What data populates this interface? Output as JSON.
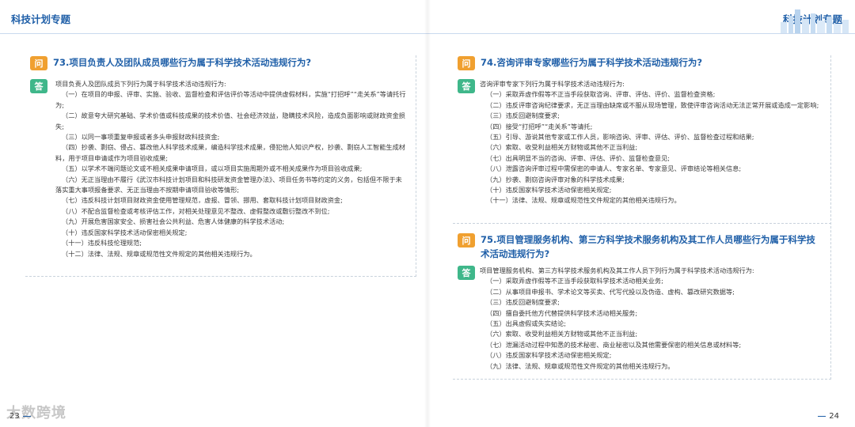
{
  "header": {
    "left_title": "科技计划专题",
    "right_title": "科技计划专题"
  },
  "icons": {
    "question": "问",
    "answer": "答"
  },
  "q73": {
    "question": "73.项目负责人及团队成员哪些行为属于科学技术活动违规行为?",
    "intro": "项目负责人及团队成员下列行为属于科学技术活动违规行为:",
    "items": [
      "（一）在项目的申报、评审、实施、验收、监督检查和评估评价等活动中提供虚假材料，实施“打招呼”“走关系”等请托行为;",
      "（二）故意夸大研究基础、学术价值或科技成果的技术价值、社会经济效益，隐瞒技术风险，造成负面影响或财政资金损失;",
      "（三）以同一事项重复申报或者多头申报财政科技资金;",
      "（四）抄袭、剽窃、侵占、篡改他人科学技术成果，编造科学技术成果，侵犯他人知识产权，抄袭、剽窃人工智能生成材料，用于项目申请或作为项目验收成果;",
      "（五）以学术不端问题论文或不相关成果申请项目，或以项目实施周期外或不相关成果作为项目验收成果;",
      "（六）无正当理由不履行《武汉市科技计划项目和科技研发资金管理办法》、项目任务书等约定的义务，包括但不限于未落实重大事项报备要求、无正当理由不按期申请项目验收等情形;",
      "（七）违反科技计划项目财政资金使用管理规范，虚报、冒领、挪用、套取科技计划项目财政资金;",
      "（八）不配合监督检查或考核评估工作，对相关处理意见不整改、虚假整改或敷衍整改不到位;",
      "（九）开展危害国家安全、损害社会公共利益、危害人体健康的科学技术活动;",
      "（十）违反国家科学技术活动保密相关规定;",
      "（十一）违反科技伦理规范;",
      "（十二）法律、法规、规章或规范性文件规定的其他相关违规行为。"
    ]
  },
  "q74": {
    "question": "74.咨询评审专家哪些行为属于科学技术活动违规行为?",
    "intro": "咨询评审专家下列行为属于科学技术活动违规行为:",
    "items": [
      "（一）采取弄虚作假等不正当手段获取咨询、评审、评估、评价、监督检查资格;",
      "（二）违反评审咨询纪律要求，无正当理由缺席或不服从现场管理，致使评审咨询活动无法正常开展或造成一定影响;",
      "（三）违反回避制度要求;",
      "（四）接受“打招呼”“走关系”等请托;",
      "（五）引导、游说其他专家或工作人员，影响咨询、评审、评估、评价、监督检查过程和结果;",
      "（六）索取、收受利益相关方财物或其他不正当利益;",
      "（七）出具明显不当的咨询、评审、评估、评价、监督检查意见;",
      "（八）泄露咨询评审过程中需保密的申请人、专家名单、专家意见、评审结论等相关信息;",
      "（九）抄袭、剽窃咨询评审对象的科学技术成果;",
      "（十）违反国家科学技术活动保密相关规定;",
      "（十一）法律、法规、规章或规范性文件规定的其他相关违规行为。"
    ]
  },
  "q75": {
    "question": "75.项目管理服务机构、第三方科学技术服务机构及其工作人员哪些行为属于科学技术活动违规行为?",
    "intro": "项目管理服务机构、第三方科学技术服务机构及其工作人员下列行为属于科学技术活动违规行为:",
    "items": [
      "（一）采取弄虚作假等不正当手段获取科学技术活动相关业务;",
      "（二）从事项目申报书、学术论文等买卖、代写代投以及伪造、虚构、篡改研究数据等;",
      "（三）违反回避制度要求;",
      "（四）擅自委托他方代替提供科学技术活动相关服务;",
      "（五）出具虚假或失实结论;",
      "（六）索取、收受利益相关方财物或其他不正当利益;",
      "（七）泄漏活动过程中知悉的技术秘密、商业秘密以及其他需要保密的相关信息或材料等;",
      "（八）违反国家科学技术活动保密相关规定;",
      "（九）法律、法规、规章或规范性文件规定的其他相关违规行为。"
    ]
  },
  "footer": {
    "left_page": "23",
    "right_page": "24",
    "watermark": "大数跨境"
  },
  "colors": {
    "primary_blue": "#1f5fa8",
    "question_orange": "#f0a030",
    "answer_green": "#3fb78a"
  }
}
